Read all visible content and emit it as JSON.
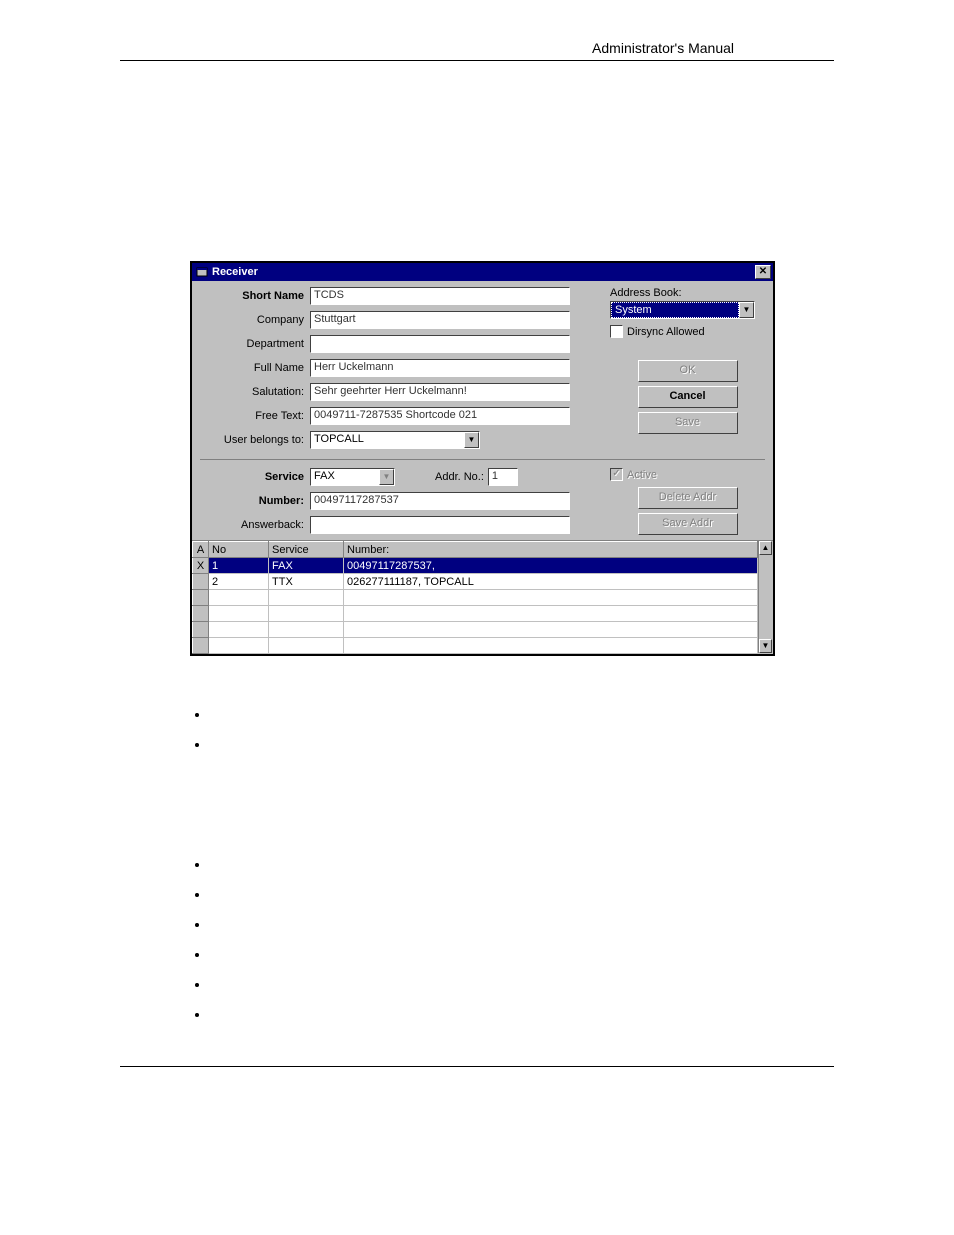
{
  "page_header": "Administrator's Manual",
  "dialog": {
    "title": "Receiver",
    "labels": {
      "short_name": "Short Name",
      "company": "Company",
      "department": "Department",
      "full_name": "Full Name",
      "salutation": "Salutation:",
      "free_text": "Free Text:",
      "user_belongs": "User belongs to:",
      "address_book": "Address Book:",
      "dirsync": "Dirsync Allowed",
      "service": "Service",
      "addr_no": "Addr. No.:",
      "number": "Number:",
      "answerback": "Answerback:",
      "active": "Active"
    },
    "values": {
      "short_name": "TCDS",
      "company": "Stuttgart",
      "department": "",
      "full_name": "Herr Uckelmann",
      "salutation": "Sehr geehrter Herr Uckelmann!",
      "free_text": "0049711-7287535    Shortcode 021",
      "user_belongs": "TOPCALL",
      "address_book": "System",
      "dirsync_checked": false,
      "service": "FAX",
      "addr_no": "1",
      "number": "00497117287537",
      "answerback": "",
      "active_checked": true
    },
    "buttons": {
      "ok": "OK",
      "cancel": "Cancel",
      "save": "Save",
      "delete_addr": "Delete Addr",
      "save_addr": "Save Addr"
    },
    "grid": {
      "headers": {
        "a": "A",
        "no": "No",
        "service": "Service",
        "number": "Number:"
      },
      "rows": [
        {
          "a": "X",
          "no": "1",
          "service": "FAX",
          "number": "00497117287537,",
          "selected": true
        },
        {
          "a": "",
          "no": "2",
          "service": "TTX",
          "number": "026277111187, TOPCALL",
          "selected": false
        }
      ]
    }
  }
}
